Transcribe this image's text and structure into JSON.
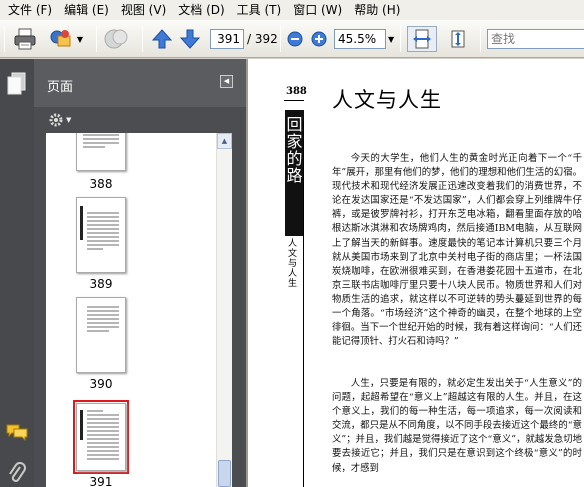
{
  "menu": [
    "文件 (F)",
    "编辑 (E)",
    "视图 (V)",
    "文档 (D)",
    "工具 (T)",
    "窗口 (W)",
    "帮助 (H)"
  ],
  "toolbar": {
    "current_page": "391",
    "total_pages": "/ 392",
    "zoom": "45.5%",
    "search_placeholder": "查找"
  },
  "nav_panel": {
    "title": "页面",
    "thumbnails": [
      {
        "label": "388"
      },
      {
        "label": "389"
      },
      {
        "label": "390"
      },
      {
        "label": "391",
        "selected": true
      }
    ]
  },
  "document": {
    "page_number": "388",
    "section_block": "回家的路",
    "side_title": "人文与人生",
    "title": "人文与人生",
    "paragraphs": [
      "今天的大学生，他们人生的黄金时光正向着下一个“千年”展开，那里有他们的梦，他们的理想和他们生活的幻宿。现代技术和现代经济发展正迅速改变着我们的消费世界，不论在发达国家还是“不发达国家”，人们都会穿上列维牌牛仔裤，或是彼罗牌衬衫，打开东芝电冰箱，翻看里面存放的哈根达斯冰淇淋和农场牌鸡肉，然后接通IBM电脑，从互联网上了解当天的新鲜事。速度最快的笔记本计算机只要三个月就从美国市场来到了北京中关村电子街的商店里；一杯法国炭烧咖啡，在欧洲很难买到，在香港娄花园十五道市，在北京三联书店咖啡厅里只要十八块人民币。物质世界和人们对物质生活的追求，就这样以不可逆转的势头蔓延到世界的每一个角落。“市场经济”这个神奇的幽灵，在整个地球的上空徘徊。当下一个世纪开始的时候，我有着这样询问：“人们还能记得顶针、打火石和诗吗？”",
      "人生，只要是有限的，就必定生发出关于“人生意义”的问题，起超希望在“意义上”超越这有限的人生。并且，在这个意义上，我们的每一种生活，每一项追求，每一次阅读和交流，都只是从不同角度，以不同手段去接近这个最终的“意义”；并且，我们越是觉得接近了这个“意义”，就越发急切地要去接近它；并且，我们只是在意识到这个终极“意义”的时候，才感到"
    ]
  }
}
